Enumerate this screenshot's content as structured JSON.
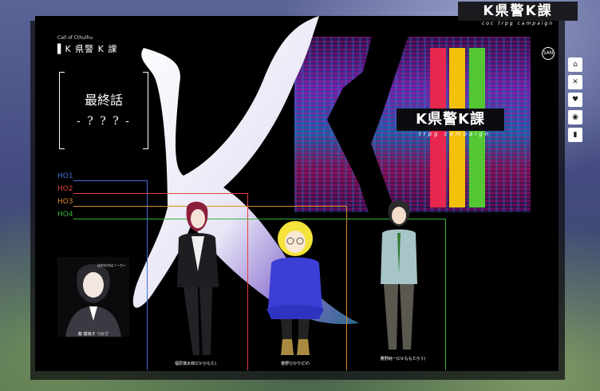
{
  "brand": {
    "top_logo": "K県警K課",
    "top_tag": "coc trpg campaign",
    "mid_logo": "K県警K課",
    "mid_tag": "trpg campaign",
    "small_logo": "▌K 県警 K 課",
    "subtitle": "Call of Cthulhu"
  },
  "episode": {
    "title": "最終話",
    "name": "- ? ? ? -"
  },
  "handouts": [
    {
      "label": "HO1",
      "color": "#3f6fd8"
    },
    {
      "label": "HO2",
      "color": "#e0443a"
    },
    {
      "label": "HO3",
      "color": "#e08a2a"
    },
    {
      "label": "HO4",
      "color": "#36b03a"
    }
  ],
  "characters": [
    {
      "name": "龍 瑠璃子 つかさ",
      "note": "ほかの方はノーカー"
    },
    {
      "name": "福原慎太郎(CV:かもた)"
    },
    {
      "name": "春野ひかり(CV)"
    },
    {
      "name": "鷹野純一(CV:ももたろう)"
    }
  ],
  "side_buttons": [
    "home-icon",
    "crosshair-icon",
    "heart-icon",
    "eye-icon",
    "bar-chart-icon"
  ],
  "round_button": "SAN",
  "colors": {
    "stripe_red": "#e8274e",
    "stripe_yellow": "#f3c10a",
    "stripe_green": "#53c734"
  }
}
